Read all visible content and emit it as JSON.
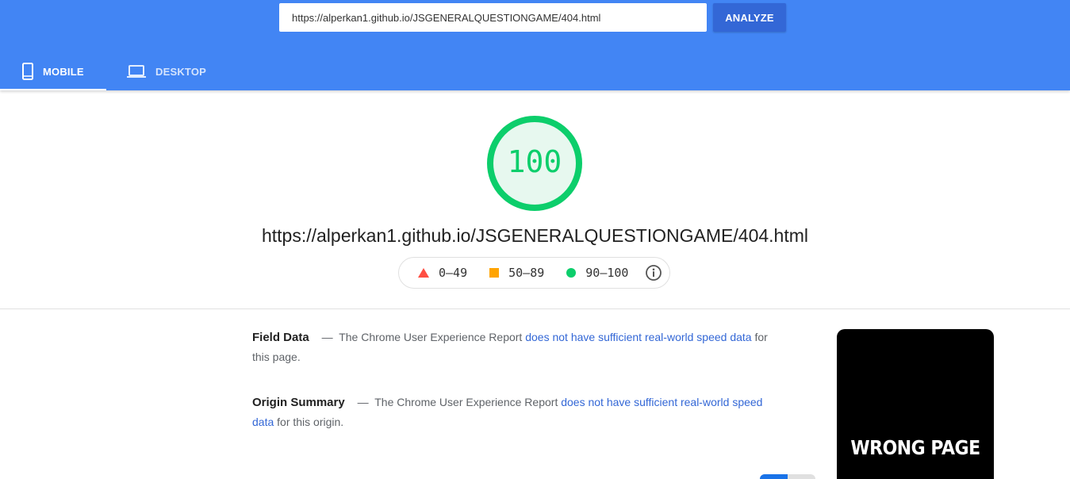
{
  "header": {
    "url_value": "https://alperkan1.github.io/JSGENERALQUESTIONGAME/404.html",
    "analyze_label": "ANALYZE",
    "tabs": [
      {
        "label": "MOBILE",
        "icon": "mobile-phone-icon",
        "active": true
      },
      {
        "label": "DESKTOP",
        "icon": "laptop-icon",
        "active": false
      }
    ],
    "bg_color": "#4285f4"
  },
  "score": {
    "value": "100",
    "color": "#0cce6b",
    "fraction": 1.0
  },
  "page_url": "https://alperkan1.github.io/JSGENERALQUESTIONGAME/404.html",
  "legend": {
    "items": [
      {
        "range": "0–49",
        "shape": "triangle",
        "color": "#ff4e42"
      },
      {
        "range": "50–89",
        "shape": "square",
        "color": "#ffa400"
      },
      {
        "range": "90–100",
        "shape": "circle",
        "color": "#0cce6b"
      }
    ],
    "info_icon": "info-icon"
  },
  "field_data": {
    "title": "Field Data",
    "dash": "—",
    "prefix": "The Chrome User Experience Report",
    "link": "does not have sufficient real-world speed data",
    "suffix": "for this page."
  },
  "origin_summary": {
    "title": "Origin Summary",
    "dash": "—",
    "prefix": "The Chrome User Experience Report",
    "link": "does not have sufficient real-world speed data",
    "suffix": "for this origin."
  },
  "screenshot": {
    "text": "WRONG PAGE"
  }
}
